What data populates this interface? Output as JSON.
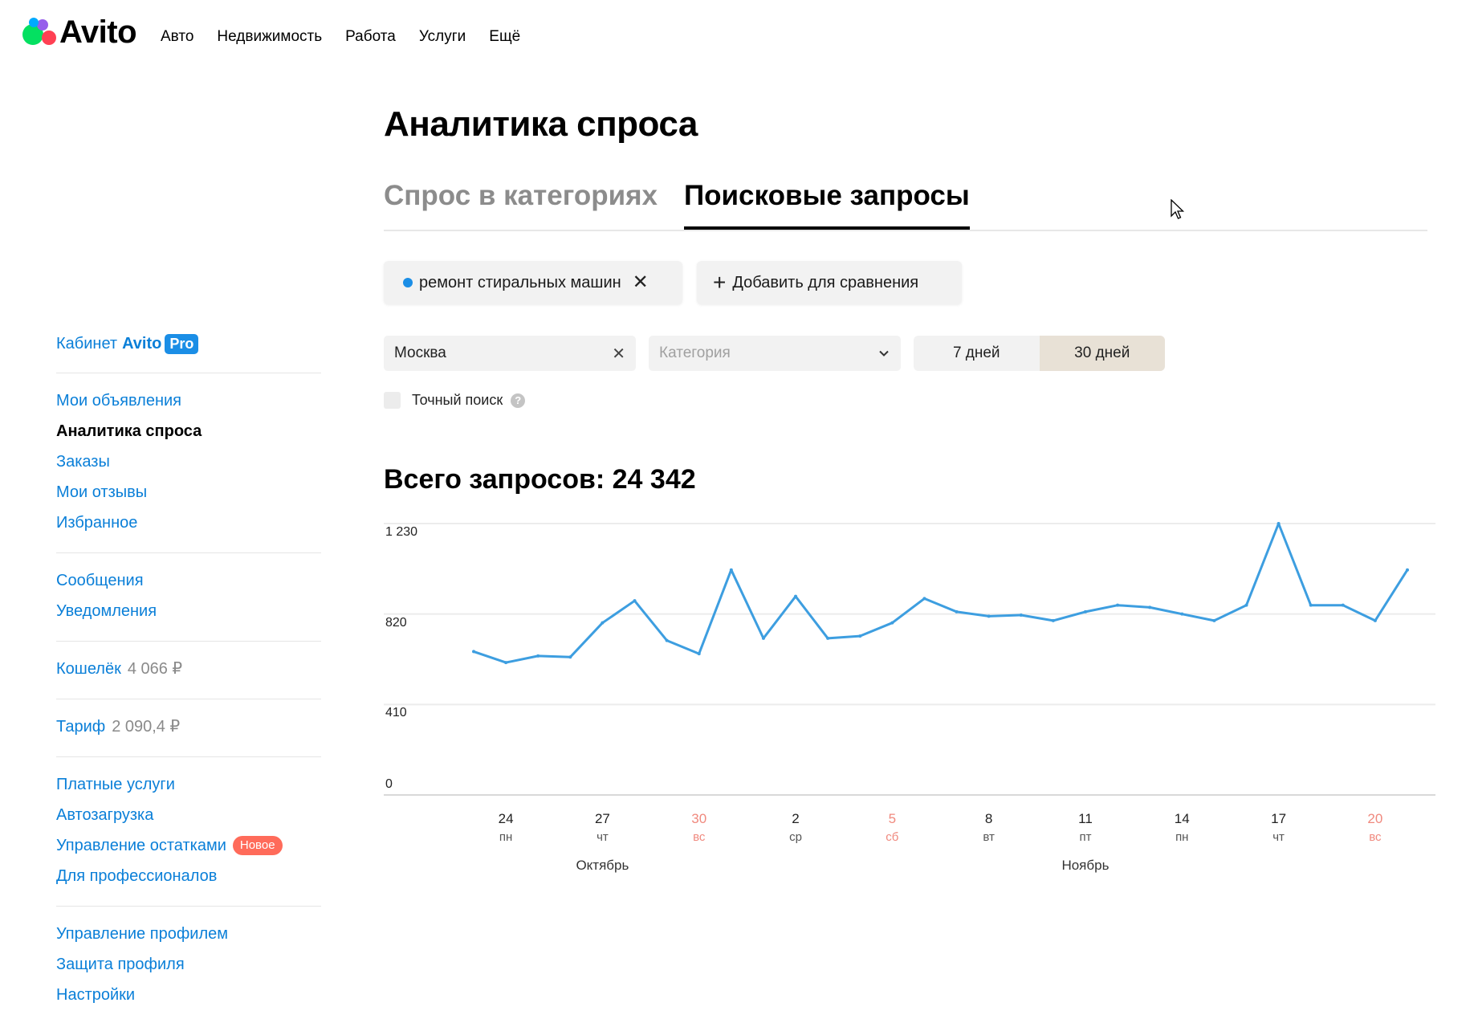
{
  "header": {
    "logo_text": "Avito",
    "nav": [
      "Авто",
      "Недвижимость",
      "Работа",
      "Услуги",
      "Ещё"
    ]
  },
  "sidebar": {
    "cabinet_label": "Кабинет",
    "cabinet_brand": "Avito",
    "cabinet_badge": "Pro",
    "group1": [
      "Мои объявления",
      "Аналитика спроса",
      "Заказы",
      "Мои отзывы",
      "Избранное"
    ],
    "group2": [
      "Сообщения",
      "Уведомления"
    ],
    "wallet_label": "Кошелёк",
    "wallet_value": "4 066 ₽",
    "tariff_label": "Тариф",
    "tariff_value": "2 090,4 ₽",
    "group5": [
      "Платные услуги",
      "Автозагрузка",
      "Управление остатками",
      "Для профессионалов"
    ],
    "new_badge": "Новое",
    "group6": [
      "Управление профилем",
      "Защита профиля",
      "Настройки"
    ]
  },
  "main": {
    "title": "Аналитика спроса",
    "tabs": [
      "Спрос в категориях",
      "Поисковые запросы"
    ],
    "query_chip": "ремонт стиральных машин",
    "add_compare": "Добавить для сравнения",
    "city_value": "Москва",
    "category_placeholder": "Категория",
    "period_options": [
      "7 дней",
      "30 дней"
    ],
    "exact_search": "Точный поиск",
    "help_glyph": "?",
    "total_label": "Всего запросов:",
    "total_value": "24 342"
  },
  "colors": {
    "accent": "#0a7fd8",
    "line": "#3d9ee0",
    "weekend": "#f0897e",
    "selected_period": "#e8e1d6"
  },
  "chart_data": {
    "type": "line",
    "y_ticks": [
      "0",
      "410",
      "820",
      "1 230"
    ],
    "ylim": [
      0,
      1230
    ],
    "x_ticks": [
      {
        "day": "24",
        "weekday": "пн",
        "weekend": false
      },
      {
        "day": "27",
        "weekday": "чт",
        "weekend": false
      },
      {
        "day": "30",
        "weekday": "вс",
        "weekend": true
      },
      {
        "day": "2",
        "weekday": "ср",
        "weekend": false
      },
      {
        "day": "5",
        "weekday": "сб",
        "weekend": true
      },
      {
        "day": "8",
        "weekday": "вт",
        "weekend": false
      },
      {
        "day": "11",
        "weekday": "пт",
        "weekend": false
      },
      {
        "day": "14",
        "weekday": "пн",
        "weekend": false
      },
      {
        "day": "17",
        "weekday": "чт",
        "weekend": false
      },
      {
        "day": "20",
        "weekday": "вс",
        "weekend": true
      }
    ],
    "months": [
      "Октябрь",
      "Ноябрь"
    ],
    "series": [
      {
        "values": [
          650,
          600,
          630,
          625,
          780,
          880,
          700,
          640,
          1020,
          710,
          900,
          710,
          720,
          780,
          890,
          830,
          810,
          815,
          790,
          830,
          860,
          850,
          820,
          790,
          860,
          1230,
          860,
          860,
          790,
          1020
        ]
      }
    ]
  }
}
